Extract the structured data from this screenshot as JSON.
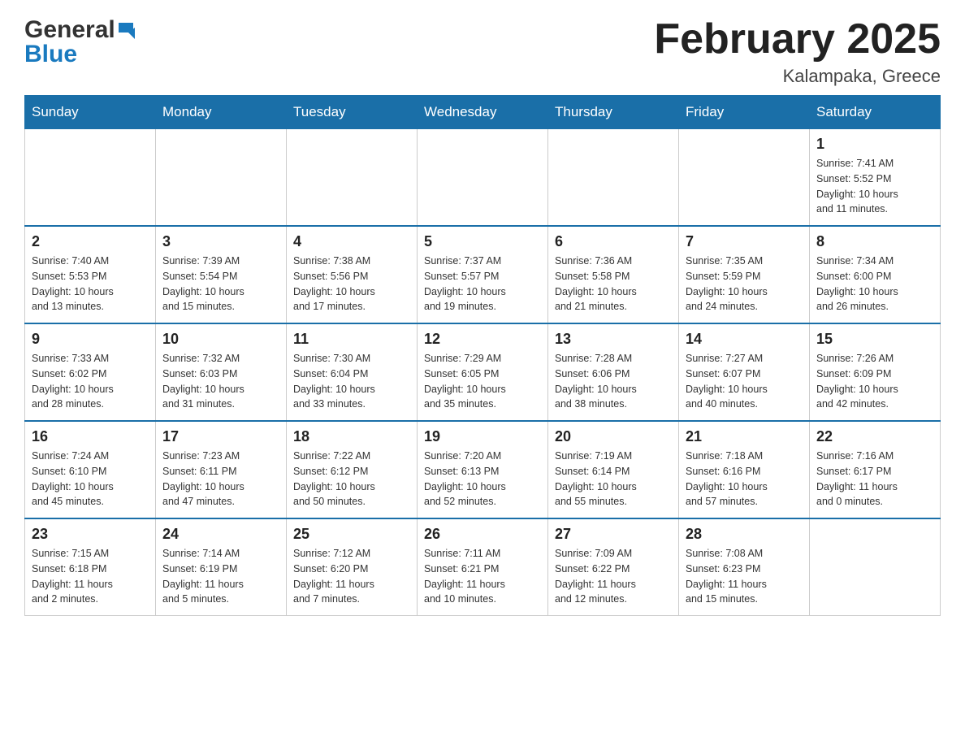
{
  "logo": {
    "general": "General",
    "blue": "Blue"
  },
  "header": {
    "month_year": "February 2025",
    "location": "Kalampaka, Greece"
  },
  "days_of_week": [
    "Sunday",
    "Monday",
    "Tuesday",
    "Wednesday",
    "Thursday",
    "Friday",
    "Saturday"
  ],
  "weeks": [
    [
      {
        "day": "",
        "info": ""
      },
      {
        "day": "",
        "info": ""
      },
      {
        "day": "",
        "info": ""
      },
      {
        "day": "",
        "info": ""
      },
      {
        "day": "",
        "info": ""
      },
      {
        "day": "",
        "info": ""
      },
      {
        "day": "1",
        "info": "Sunrise: 7:41 AM\nSunset: 5:52 PM\nDaylight: 10 hours\nand 11 minutes."
      }
    ],
    [
      {
        "day": "2",
        "info": "Sunrise: 7:40 AM\nSunset: 5:53 PM\nDaylight: 10 hours\nand 13 minutes."
      },
      {
        "day": "3",
        "info": "Sunrise: 7:39 AM\nSunset: 5:54 PM\nDaylight: 10 hours\nand 15 minutes."
      },
      {
        "day": "4",
        "info": "Sunrise: 7:38 AM\nSunset: 5:56 PM\nDaylight: 10 hours\nand 17 minutes."
      },
      {
        "day": "5",
        "info": "Sunrise: 7:37 AM\nSunset: 5:57 PM\nDaylight: 10 hours\nand 19 minutes."
      },
      {
        "day": "6",
        "info": "Sunrise: 7:36 AM\nSunset: 5:58 PM\nDaylight: 10 hours\nand 21 minutes."
      },
      {
        "day": "7",
        "info": "Sunrise: 7:35 AM\nSunset: 5:59 PM\nDaylight: 10 hours\nand 24 minutes."
      },
      {
        "day": "8",
        "info": "Sunrise: 7:34 AM\nSunset: 6:00 PM\nDaylight: 10 hours\nand 26 minutes."
      }
    ],
    [
      {
        "day": "9",
        "info": "Sunrise: 7:33 AM\nSunset: 6:02 PM\nDaylight: 10 hours\nand 28 minutes."
      },
      {
        "day": "10",
        "info": "Sunrise: 7:32 AM\nSunset: 6:03 PM\nDaylight: 10 hours\nand 31 minutes."
      },
      {
        "day": "11",
        "info": "Sunrise: 7:30 AM\nSunset: 6:04 PM\nDaylight: 10 hours\nand 33 minutes."
      },
      {
        "day": "12",
        "info": "Sunrise: 7:29 AM\nSunset: 6:05 PM\nDaylight: 10 hours\nand 35 minutes."
      },
      {
        "day": "13",
        "info": "Sunrise: 7:28 AM\nSunset: 6:06 PM\nDaylight: 10 hours\nand 38 minutes."
      },
      {
        "day": "14",
        "info": "Sunrise: 7:27 AM\nSunset: 6:07 PM\nDaylight: 10 hours\nand 40 minutes."
      },
      {
        "day": "15",
        "info": "Sunrise: 7:26 AM\nSunset: 6:09 PM\nDaylight: 10 hours\nand 42 minutes."
      }
    ],
    [
      {
        "day": "16",
        "info": "Sunrise: 7:24 AM\nSunset: 6:10 PM\nDaylight: 10 hours\nand 45 minutes."
      },
      {
        "day": "17",
        "info": "Sunrise: 7:23 AM\nSunset: 6:11 PM\nDaylight: 10 hours\nand 47 minutes."
      },
      {
        "day": "18",
        "info": "Sunrise: 7:22 AM\nSunset: 6:12 PM\nDaylight: 10 hours\nand 50 minutes."
      },
      {
        "day": "19",
        "info": "Sunrise: 7:20 AM\nSunset: 6:13 PM\nDaylight: 10 hours\nand 52 minutes."
      },
      {
        "day": "20",
        "info": "Sunrise: 7:19 AM\nSunset: 6:14 PM\nDaylight: 10 hours\nand 55 minutes."
      },
      {
        "day": "21",
        "info": "Sunrise: 7:18 AM\nSunset: 6:16 PM\nDaylight: 10 hours\nand 57 minutes."
      },
      {
        "day": "22",
        "info": "Sunrise: 7:16 AM\nSunset: 6:17 PM\nDaylight: 11 hours\nand 0 minutes."
      }
    ],
    [
      {
        "day": "23",
        "info": "Sunrise: 7:15 AM\nSunset: 6:18 PM\nDaylight: 11 hours\nand 2 minutes."
      },
      {
        "day": "24",
        "info": "Sunrise: 7:14 AM\nSunset: 6:19 PM\nDaylight: 11 hours\nand 5 minutes."
      },
      {
        "day": "25",
        "info": "Sunrise: 7:12 AM\nSunset: 6:20 PM\nDaylight: 11 hours\nand 7 minutes."
      },
      {
        "day": "26",
        "info": "Sunrise: 7:11 AM\nSunset: 6:21 PM\nDaylight: 11 hours\nand 10 minutes."
      },
      {
        "day": "27",
        "info": "Sunrise: 7:09 AM\nSunset: 6:22 PM\nDaylight: 11 hours\nand 12 minutes."
      },
      {
        "day": "28",
        "info": "Sunrise: 7:08 AM\nSunset: 6:23 PM\nDaylight: 11 hours\nand 15 minutes."
      },
      {
        "day": "",
        "info": ""
      }
    ]
  ]
}
